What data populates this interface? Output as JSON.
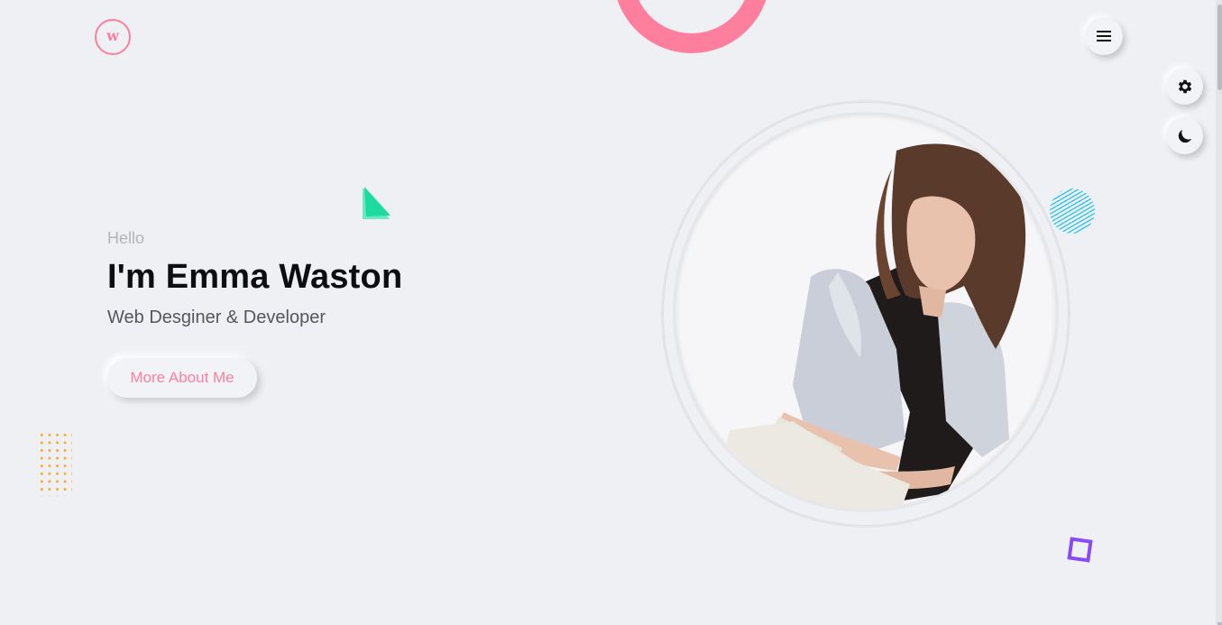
{
  "header": {
    "logo_letter": "w",
    "menu_icon": "hamburger-icon"
  },
  "side_buttons": {
    "settings_icon": "gear-icon",
    "theme_icon": "moon-icon"
  },
  "hero": {
    "greeting": "Hello",
    "name": "I'm Emma Waston",
    "role": "Web Desginer & Developer",
    "cta_label": "More About Me"
  },
  "colors": {
    "accent_pink": "#fd7f9d",
    "background": "#eff0f4",
    "green_triangle": "#1ddb9e",
    "dots_orange": "#f7a81f",
    "stripe_cyan": "#35c6e8",
    "purple_square": "#8a4bf2"
  }
}
